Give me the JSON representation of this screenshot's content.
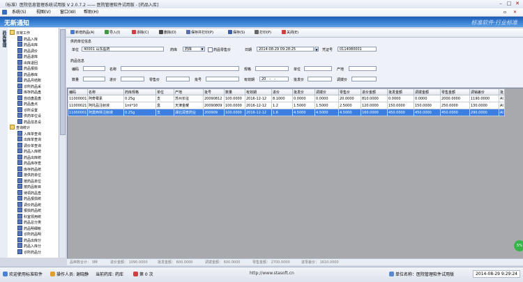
{
  "window": {
    "title": "（标准）医院信息管理系统试用版 V 2.0.7.2 ——  医院管理软件试用版 - [药品入库]"
  },
  "menu": [
    "系统(S)",
    "视图(V)",
    "窗口(W)",
    "帮助(H)"
  ],
  "banner": {
    "left": "无新通知",
    "right": "标准软件·行业标准"
  },
  "sidebar": {
    "tab_label": "药库管理",
    "tree": [
      {
        "label": "日常工作",
        "level": 0,
        "folder": true
      },
      {
        "label": "药品入库",
        "level": 1
      },
      {
        "label": "药品出库",
        "level": 1
      },
      {
        "label": "药品调价",
        "level": 1
      },
      {
        "label": "药品退库",
        "level": 1
      },
      {
        "label": "出库退回",
        "level": 1
      },
      {
        "label": "药品报损",
        "level": 1
      },
      {
        "label": "药品移库",
        "level": 1
      },
      {
        "label": "药品月结账",
        "level": 1
      },
      {
        "label": "诊所药品采",
        "level": 1
      },
      {
        "label": "库存药品盘",
        "level": 1
      },
      {
        "label": "自动盘盈盘",
        "level": 1
      },
      {
        "label": "药品盘点",
        "level": 1
      },
      {
        "label": "诊所设置",
        "level": 1
      },
      {
        "label": "供药单位设",
        "level": 1
      },
      {
        "label": "药品信息设",
        "level": 1
      },
      {
        "label": "查询统计",
        "level": 0,
        "folder": true
      },
      {
        "label": "入库单查询",
        "level": 1
      },
      {
        "label": "出库单查询",
        "level": 1
      },
      {
        "label": "调价单查询",
        "level": 1
      },
      {
        "label": "药品入库统",
        "level": 1
      },
      {
        "label": "药品出库统",
        "level": 1
      },
      {
        "label": "药品库存查",
        "level": 1
      },
      {
        "label": "库存药品统",
        "level": 1
      },
      {
        "label": "按供药单位",
        "level": 1
      },
      {
        "label": "按药品单位",
        "level": 1
      },
      {
        "label": "按药品帐目",
        "level": 1
      },
      {
        "label": "待领药品查",
        "level": 1
      },
      {
        "label": "药品报损统",
        "level": 1
      },
      {
        "label": "调价药品统",
        "level": 1
      },
      {
        "label": "报损药品统",
        "level": 1
      },
      {
        "label": "科室领用统",
        "level": 1
      },
      {
        "label": "药品总分类",
        "level": 1
      },
      {
        "label": "药品明细帐",
        "level": 1
      },
      {
        "label": "诊所药品明",
        "level": 1
      },
      {
        "label": "药品出库分",
        "level": 1
      },
      {
        "label": "药品入库分",
        "level": 1
      },
      {
        "label": "诊所药品分",
        "level": 1
      }
    ]
  },
  "toolbar": [
    {
      "label": "新增药品(A)",
      "icon": "document-new-icon",
      "color": "#4a7bd0"
    },
    {
      "label": "导入(I)",
      "icon": "import-icon",
      "color": "#3d9a3d"
    },
    {
      "label": "添除(C)",
      "icon": "clear-icon",
      "color": "#d04040"
    },
    {
      "label": "删除(D)",
      "icon": "delete-icon",
      "color": "#444444"
    },
    {
      "label": "保存并打印(P)",
      "icon": "save-print-icon",
      "color": "#5a6fb0"
    },
    {
      "label": "保存(S)",
      "icon": "save-icon",
      "color": "#3a5fa8"
    },
    {
      "label": "打印(P)",
      "icon": "printer-icon",
      "color": "#666666"
    },
    {
      "label": "关闭(E)",
      "icon": "close-icon",
      "color": "#d04040"
    }
  ],
  "supplier": {
    "section": "供药单位信息",
    "unit_label": "单位",
    "unit_value": "40001 山东医药",
    "store_label": "药库",
    "store_value": "药库",
    "self_label": "药品零售价",
    "date_label": "日期",
    "date_value": "2014-08-29 09:28:25",
    "voucher_label": "凭证号",
    "voucher_value": "0114080001"
  },
  "drug_info": {
    "section": "药品信息",
    "code": "编码",
    "name": "名称",
    "spec": "规格",
    "unit": "单位",
    "origin": "产地",
    "qty": "数量",
    "in_price": "进价",
    "retail_price": "零售价",
    "batch": "批号",
    "expire": "有效期",
    "expire_value": "20__-__-__",
    "wholesale": "批发价",
    "transfer": "调拨价"
  },
  "grid": {
    "columns": [
      "编码",
      "名称",
      "药库规格",
      "单位",
      "产地",
      "批号",
      "数量",
      "有效期",
      "进价",
      "批发价",
      "调拨价",
      "零售价",
      "进价金额",
      "批发金额",
      "调拨金额",
      "零售金额",
      "调销差价",
      "批"
    ],
    "rows": [
      [
        "11000001",
        "阿奇霉素",
        "0.25g",
        "支",
        "苏州长征",
        "20090812",
        "100.0000",
        "2016-12-12",
        "8.1000",
        "0.0000",
        "0.0000",
        "20.0000",
        "810.0000",
        "0.0000",
        "0.0000",
        "2000.0000",
        "1190.0000",
        "AI"
      ],
      [
        "11000021",
        "阿托品注射液",
        "1ml*10",
        "盒",
        "天津金耀",
        "20090809",
        "100.0000",
        "2016-12-12",
        "1.2",
        "1.5000",
        "1.5000",
        "2.5000",
        "120.0000",
        "150.0000",
        "150.0000",
        "250.0000",
        "130.0000",
        "AI"
      ],
      [
        "11000001",
        "阿莫西林注射液",
        "0.25g",
        "支",
        "湖北润普药业",
        "200909",
        "100.0000",
        "2016-12-12",
        "1.6",
        "4.5000",
        "4.5000",
        "4.5000",
        "160.0000",
        "450.0000",
        "450.0000",
        "450.0000",
        "290.0000",
        "AI"
      ]
    ],
    "selected_row": 2
  },
  "summary": [
    "品种数合计：  3种",
    "进价金额：  1090.0000",
    "批发金额：  600.0000",
    "调拨金额：  600.0000",
    "零售金额：  2700.0000",
    "进零差价：  1610.0000"
  ],
  "statusbar": {
    "welcome": "欢迎使用标准软件",
    "operator_label": "操作人员:",
    "operator": "谢晓静",
    "store_label": "当前药库:",
    "store": "药库",
    "page_label": "第 0 次",
    "url": "http://www.stasoft.cn",
    "company_label": "单位名称：",
    "company": "医院管理软件试用版",
    "datetime": "2014-08-29 9:29:24"
  },
  "colors": {
    "banner": "#2a6fc8",
    "selected_row": "#3b7fe0",
    "grid_bg": "#a7a9ad"
  }
}
